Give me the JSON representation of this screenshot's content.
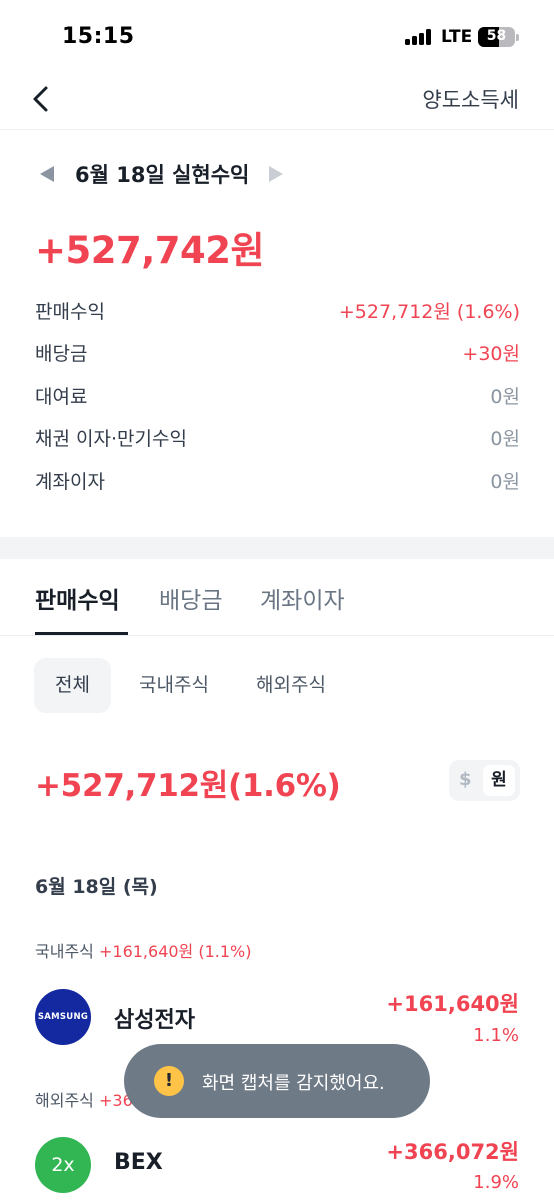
{
  "status_bar": {
    "time": "15:15",
    "network": "LTE",
    "battery": "58",
    "battery_percent": 58
  },
  "nav": {
    "title": "양도소득세"
  },
  "summary": {
    "date_label": "6월 18일 실현수익",
    "total": "+527,742원",
    "rows": [
      {
        "label": "판매수익",
        "value": "+527,712원 (1.6%)"
      },
      {
        "label": "배당금",
        "value": "+30원"
      },
      {
        "label": "대여료",
        "value": "0원"
      },
      {
        "label": "채권 이자·만기수익",
        "value": "0원"
      },
      {
        "label": "계좌이자",
        "value": "0원"
      }
    ]
  },
  "tabs": [
    "판매수익",
    "배당금",
    "계좌이자"
  ],
  "chips": [
    "전체",
    "국내주식",
    "해외주식"
  ],
  "sales": {
    "total": "+527,712원(1.6%)",
    "currency_usd": "$",
    "currency_krw": "원"
  },
  "day": {
    "heading": "6월 18일 (목)",
    "domestic": {
      "label": "국내주식",
      "amount": "+161,640원 (1.1%)",
      "stock": {
        "logo": "SAMSUNG",
        "name": "삼성전자",
        "amount": "+161,640원",
        "pct": "1.1%"
      }
    },
    "overseas": {
      "label": "해외주식",
      "amount_visible": "+36",
      "stock": {
        "logo": "2x",
        "name": "BEX",
        "amount": "+366,072원",
        "pct": "1.9%"
      }
    }
  },
  "toast": {
    "icon": "!",
    "text": "화면 캡처를 감지했어요."
  },
  "colors": {
    "red": "#f04452",
    "text": "#191f28",
    "gray": "#8b95a1",
    "samsung_blue": "#1428a0",
    "bex_green": "#32b653",
    "toast_bg": "#6b7684"
  }
}
